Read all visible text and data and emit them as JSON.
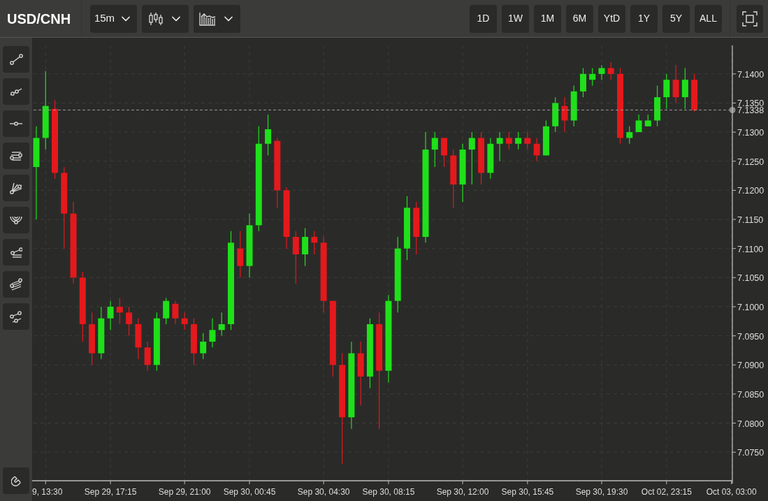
{
  "toolbar": {
    "symbol": "USD/CNH",
    "interval": "15m",
    "ranges": [
      {
        "label": "1D",
        "selected": false
      },
      {
        "label": "1W",
        "selected": false
      },
      {
        "label": "1M",
        "selected": false
      },
      {
        "label": "6M",
        "selected": false
      },
      {
        "label": "YtD",
        "selected": false
      },
      {
        "label": "1Y",
        "selected": false
      },
      {
        "label": "5Y",
        "selected": false
      },
      {
        "label": "ALL",
        "selected": false
      }
    ]
  },
  "chart": {
    "chart_data": {
      "type": "candlestick",
      "ylim": [
        7.0701,
        7.1449
      ],
      "categories": [
        null,
        "9, 13:30",
        null,
        null,
        null,
        null,
        null,
        null,
        "Sep 29, 17:15",
        null,
        null,
        null,
        null,
        null,
        null,
        null,
        "Sep 29, 21:00",
        null,
        null,
        null,
        null,
        null,
        null,
        "Sep 30, 00:45",
        null,
        null,
        null,
        null,
        null,
        null,
        null,
        "Sep 30, 04:30",
        null,
        null,
        null,
        null,
        null,
        null,
        "Sep 30, 08:15",
        null,
        null,
        null,
        null,
        null,
        null,
        null,
        "Sep 30, 12:00",
        null,
        null,
        null,
        null,
        null,
        null,
        "Sep 30, 15:45",
        null,
        null,
        null,
        null,
        null,
        null,
        null,
        "Sep 30, 19:30",
        null,
        null,
        null,
        null,
        null,
        null,
        "Oct 02, 23:15",
        null,
        null,
        null,
        null,
        null,
        null,
        "Oct 03, 03:00"
      ],
      "yticks": [
        {
          "value": 7.075,
          "label": "7.0750"
        },
        {
          "value": 7.08,
          "label": "7.0800"
        },
        {
          "value": 7.085,
          "label": "7.0850"
        },
        {
          "value": 7.09,
          "label": "7.0900"
        },
        {
          "value": 7.095,
          "label": "7.0950"
        },
        {
          "value": 7.1,
          "label": "7.1000"
        },
        {
          "value": 7.105,
          "label": "7.1050"
        },
        {
          "value": 7.11,
          "label": "7.1100"
        },
        {
          "value": 7.115,
          "label": "7.1150"
        },
        {
          "value": 7.12,
          "label": "7.1200"
        },
        {
          "value": 7.125,
          "label": "7.1250"
        },
        {
          "value": 7.13,
          "label": "7.1300"
        },
        {
          "value": 7.135,
          "label": "7.1350"
        },
        {
          "value": 7.14,
          "label": "7.1400"
        }
      ],
      "ohlc": [
        [
          7.124,
          7.131,
          7.115,
          7.129
        ],
        [
          7.129,
          7.1405,
          7.127,
          7.1345
        ],
        [
          7.134,
          7.1355,
          7.122,
          7.123
        ],
        [
          7.123,
          7.124,
          7.11,
          7.116
        ],
        [
          7.116,
          7.118,
          7.104,
          7.105
        ],
        [
          7.105,
          7.106,
          7.094,
          7.097
        ],
        [
          7.097,
          7.099,
          7.09,
          7.092
        ],
        [
          7.092,
          7.1,
          7.091,
          7.098
        ],
        [
          7.098,
          7.101,
          7.096,
          7.1
        ],
        [
          7.1,
          7.1015,
          7.097,
          7.099
        ],
        [
          7.099,
          7.1,
          7.095,
          7.097
        ],
        [
          7.097,
          7.098,
          7.091,
          7.093
        ],
        [
          7.093,
          7.094,
          7.089,
          7.09
        ],
        [
          7.09,
          7.099,
          7.089,
          7.098
        ],
        [
          7.098,
          7.1015,
          7.097,
          7.101
        ],
        [
          7.1005,
          7.101,
          7.097,
          7.098
        ],
        [
          7.098,
          7.099,
          7.096,
          7.097
        ],
        [
          7.097,
          7.098,
          7.09,
          7.092
        ],
        [
          7.092,
          7.0955,
          7.091,
          7.094
        ],
        [
          7.094,
          7.098,
          7.093,
          7.096
        ],
        [
          7.096,
          7.099,
          7.095,
          7.097
        ],
        [
          7.097,
          7.113,
          7.096,
          7.111
        ],
        [
          7.11,
          7.113,
          7.105,
          7.107
        ],
        [
          7.107,
          7.116,
          7.105,
          7.114
        ],
        [
          7.114,
          7.131,
          7.113,
          7.128
        ],
        [
          7.128,
          7.133,
          7.126,
          7.1305
        ],
        [
          7.1285,
          7.129,
          7.117,
          7.12
        ],
        [
          7.12,
          7.1205,
          7.11,
          7.112
        ],
        [
          7.112,
          7.113,
          7.104,
          7.109
        ],
        [
          7.109,
          7.1135,
          7.107,
          7.112
        ],
        [
          7.112,
          7.113,
          7.109,
          7.111
        ],
        [
          7.111,
          7.112,
          7.099,
          7.101
        ],
        [
          7.101,
          7.101,
          7.088,
          7.09
        ],
        [
          7.09,
          7.092,
          7.073,
          7.081
        ],
        [
          7.081,
          7.094,
          7.079,
          7.092
        ],
        [
          7.092,
          7.094,
          7.083,
          7.088
        ],
        [
          7.088,
          7.098,
          7.086,
          7.097
        ],
        [
          7.097,
          7.099,
          7.079,
          7.089
        ],
        [
          7.089,
          7.102,
          7.087,
          7.101
        ],
        [
          7.101,
          7.112,
          7.099,
          7.11
        ],
        [
          7.11,
          7.119,
          7.108,
          7.117
        ],
        [
          7.117,
          7.118,
          7.109,
          7.112
        ],
        [
          7.112,
          7.13,
          7.111,
          7.127
        ],
        [
          7.127,
          7.13,
          7.124,
          7.129
        ],
        [
          7.129,
          7.129,
          7.124,
          7.126
        ],
        [
          7.126,
          7.127,
          7.117,
          7.121
        ],
        [
          7.121,
          7.128,
          7.118,
          7.127
        ],
        [
          7.127,
          7.13,
          7.121,
          7.129
        ],
        [
          7.129,
          7.13,
          7.121,
          7.123
        ],
        [
          7.123,
          7.129,
          7.122,
          7.128
        ],
        [
          7.128,
          7.13,
          7.125,
          7.129
        ],
        [
          7.129,
          7.13,
          7.127,
          7.128
        ],
        [
          7.128,
          7.13,
          7.127,
          7.129
        ],
        [
          7.129,
          7.13,
          7.127,
          7.128
        ],
        [
          7.128,
          7.129,
          7.125,
          7.126
        ],
        [
          7.126,
          7.132,
          7.126,
          7.131
        ],
        [
          7.131,
          7.136,
          7.13,
          7.135
        ],
        [
          7.1345,
          7.136,
          7.13,
          7.132
        ],
        [
          7.132,
          7.138,
          7.131,
          7.137
        ],
        [
          7.137,
          7.141,
          7.136,
          7.14
        ],
        [
          7.139,
          7.141,
          7.138,
          7.14
        ],
        [
          7.14,
          7.1415,
          7.139,
          7.141
        ],
        [
          7.141,
          7.142,
          7.139,
          7.14
        ],
        [
          7.14,
          7.141,
          7.128,
          7.129
        ],
        [
          7.129,
          7.131,
          7.128,
          7.13
        ],
        [
          7.13,
          7.133,
          7.13,
          7.132
        ],
        [
          7.131,
          7.133,
          7.131,
          7.132
        ],
        [
          7.132,
          7.138,
          7.131,
          7.136
        ],
        [
          7.136,
          7.14,
          7.134,
          7.139
        ],
        [
          7.139,
          7.1415,
          7.135,
          7.136
        ],
        [
          7.136,
          7.141,
          7.134,
          7.139
        ],
        [
          7.139,
          7.14,
          7.1335,
          7.1338
        ],
        null,
        null,
        null,
        null
      ],
      "grid": true,
      "ref_lines": [
        {
          "axis": "y",
          "value": 7.1338,
          "label": "7.1338"
        }
      ]
    }
  }
}
